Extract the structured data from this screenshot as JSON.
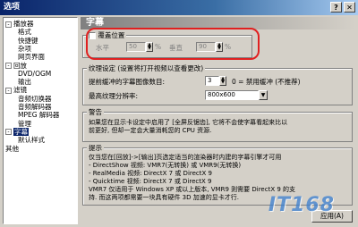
{
  "window": {
    "title": "选项"
  },
  "tree": {
    "items": [
      {
        "label": "播放器",
        "level": 0,
        "expander": "-"
      },
      {
        "label": "格式",
        "level": 1
      },
      {
        "label": "快捷键",
        "level": 1
      },
      {
        "label": "杂项",
        "level": 1
      },
      {
        "label": "网页界面",
        "level": 1
      },
      {
        "label": "回放",
        "level": 0,
        "expander": "-"
      },
      {
        "label": "DVD/OGM",
        "level": 1
      },
      {
        "label": "输出",
        "level": 1
      },
      {
        "label": "滤镜",
        "level": 0,
        "expander": "-"
      },
      {
        "label": "音频切换器",
        "level": 1
      },
      {
        "label": "音频解码器",
        "level": 1
      },
      {
        "label": "MPEG 解码器",
        "level": 1
      },
      {
        "label": "管理",
        "level": 1
      },
      {
        "label": "字幕",
        "level": 0,
        "expander": "-",
        "selected": true
      },
      {
        "label": "默认样式",
        "level": 1
      },
      {
        "label": "其他",
        "level": 0
      }
    ]
  },
  "page": {
    "title": "字幕",
    "override": {
      "checkbox_label": "覆盖位置",
      "h_label": "水平",
      "h_value": "50",
      "v_label": "垂直",
      "v_value": "90",
      "unit": "%"
    },
    "render": {
      "group_label": "纹理设定 (设置将打开视频以查看更改)",
      "buffer_label": "提前缓冲的字幕图像数目:",
      "buffer_value": "3",
      "buffer_note": "0 = 禁用缓冲 (不推荐)",
      "maxres_label": "最高纹理分辨率:",
      "maxres_value": "800x600"
    },
    "warning": {
      "group_label": "警告",
      "lines": [
        "如果您在显示卡设定中启用了 [全屏反锯齿], 它将不会使字幕看起来比以",
        "前更好, 但却一定会大量消耗您的 CPU 资源."
      ]
    },
    "tips": {
      "group_label": "提示",
      "lines": [
        "仅当您在[回放]->[输出]页选定适当的渲染器时内建的字幕引擎才可用",
        "  - DirectShow 视频:     VMR7(无转换) 或 VMR9(无转换)",
        "  - RealMedia 视频:      DirectX 7 或 DirectX 9",
        "  - Quicktime 视频:      DirectX 7 或 DirectX 9",
        "  VMR7 仅适用于 Windows XP 或以上版本, VMR9 则需要 DirectX 9 的支",
        "  持. 而这两项都需要一块具有硬件 3D 加速的显卡才行."
      ]
    }
  },
  "buttons": {
    "apply": "应用(A)"
  },
  "watermark": "IT168"
}
